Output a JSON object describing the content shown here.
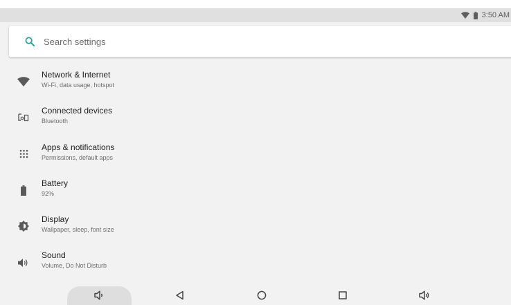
{
  "status_bar": {
    "time": "3:50 AM",
    "icons": [
      "wifi-icon",
      "battery-icon"
    ]
  },
  "search": {
    "placeholder": "Search settings",
    "icon": "search-icon",
    "accent_color": "#26a69a"
  },
  "settings_items": [
    {
      "icon": "wifi-icon",
      "title": "Network & Internet",
      "summary": "Wi-Fi, data usage, hotspot"
    },
    {
      "icon": "connected-devices-icon",
      "title": "Connected devices",
      "summary": "Bluetooth"
    },
    {
      "icon": "apps-grid-icon",
      "title": "Apps & notifications",
      "summary": "Permissions, default apps"
    },
    {
      "icon": "battery-icon",
      "title": "Battery",
      "summary": "92%"
    },
    {
      "icon": "brightness-icon",
      "title": "Display",
      "summary": "Wallpaper, sleep, font size"
    },
    {
      "icon": "volume-icon",
      "title": "Sound",
      "summary": "Volume, Do Not Disturb"
    }
  ],
  "navigation_bar": {
    "buttons": [
      "volume-down-icon",
      "back-icon",
      "home-icon",
      "recents-icon",
      "volume-up-icon"
    ]
  }
}
